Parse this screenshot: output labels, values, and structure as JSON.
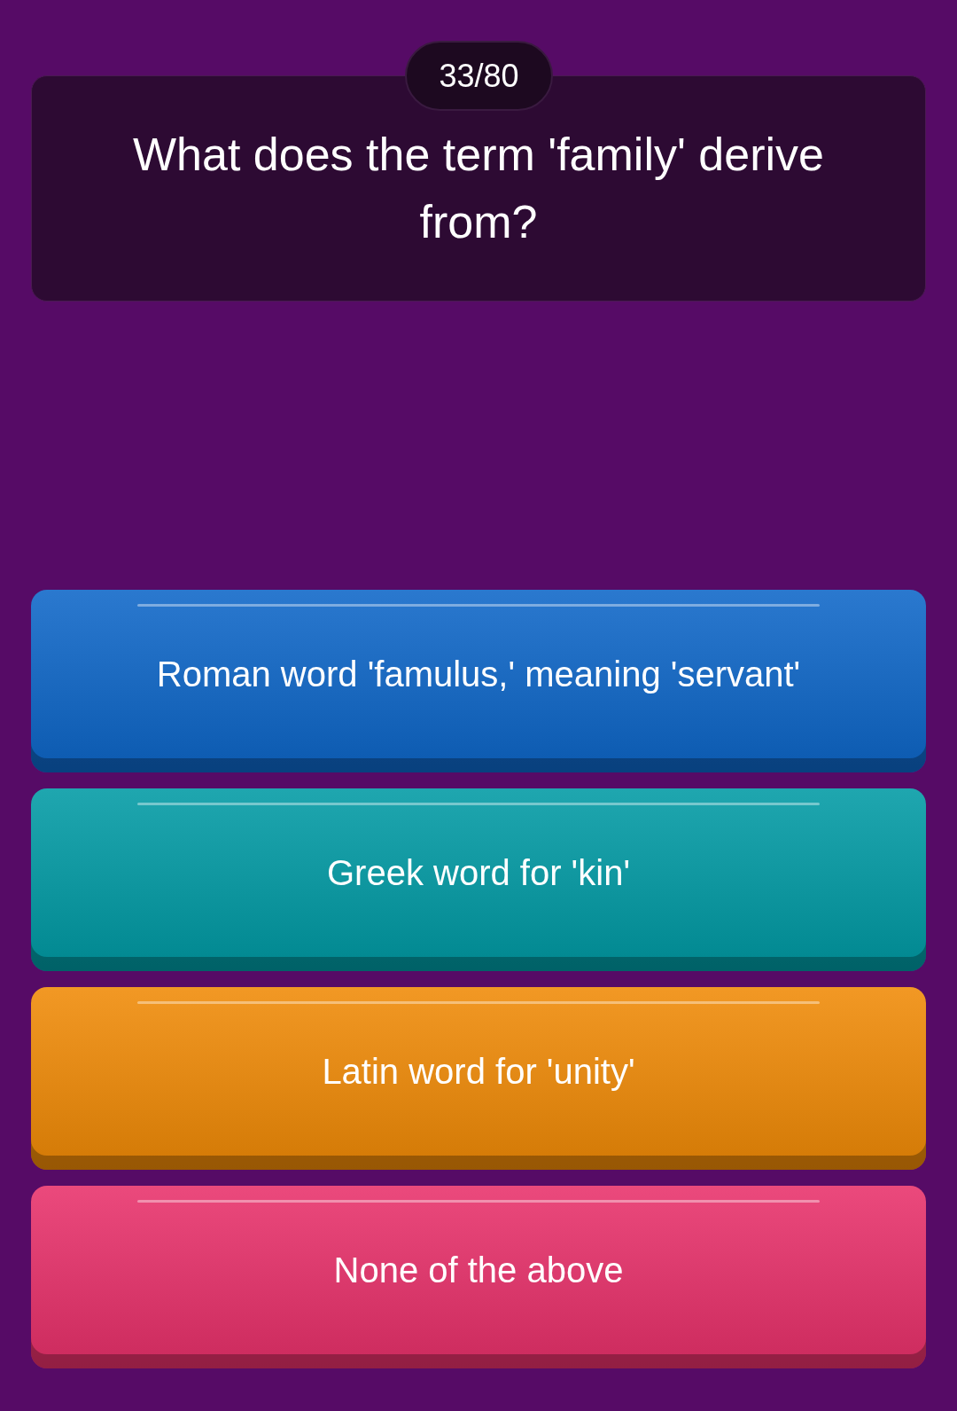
{
  "counter": "33/80",
  "question": "What does the term 'family' derive from?",
  "answers": [
    {
      "text": "Roman word 'famulus,' meaning 'servant'",
      "color": "#0d66c8"
    },
    {
      "text": "Greek word for 'kin'",
      "color": "#009aa4"
    },
    {
      "text": "Latin word for 'unity'",
      "color": "#f08a06"
    },
    {
      "text": "None of the above",
      "color": "#e8306a"
    }
  ]
}
